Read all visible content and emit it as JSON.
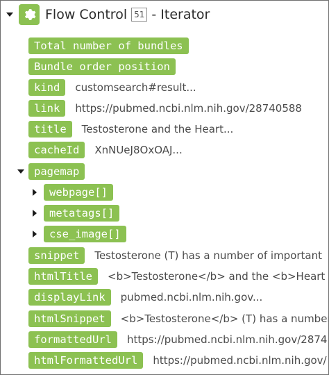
{
  "header": {
    "title": "Flow Control",
    "badge": "51",
    "suffix": "- Iterator"
  },
  "items": [
    {
      "key": "Total number of bundles",
      "value": ""
    },
    {
      "key": "Bundle order position",
      "value": ""
    },
    {
      "key": "kind",
      "value": "customsearch#result..."
    },
    {
      "key": "link",
      "value": "https://pubmed.ncbi.nlm.nih.gov/28740588"
    },
    {
      "key": "title",
      "value": "Testosterone and the Heart..."
    },
    {
      "key": "cacheId",
      "value": "XnNUeJ8OxOAJ..."
    },
    {
      "key": "pagemap",
      "value": ""
    },
    {
      "key": "webpage[]",
      "value": ""
    },
    {
      "key": "metatags[]",
      "value": ""
    },
    {
      "key": "cse_image[]",
      "value": ""
    },
    {
      "key": "snippet",
      "value": "Testosterone (T) has a number of important"
    },
    {
      "key": "htmlTitle",
      "value": "<b>Testosterone</b> and the <b>Heart"
    },
    {
      "key": "displayLink",
      "value": "pubmed.ncbi.nlm.nih.gov..."
    },
    {
      "key": "htmlSnippet",
      "value": "<b>Testosterone</b> (T) has a number"
    },
    {
      "key": "formattedUrl",
      "value": "https://pubmed.ncbi.nlm.nih.gov/2874"
    },
    {
      "key": "htmlFormattedUrl",
      "value": "https://pubmed.ncbi.nlm.nih.gov/"
    }
  ],
  "colors": {
    "accent": "#8cc152",
    "text": "#4a4a4a"
  },
  "icons": {
    "collapse": "caret-down-icon",
    "expand": "caret-right-icon",
    "module": "gear-icon"
  }
}
